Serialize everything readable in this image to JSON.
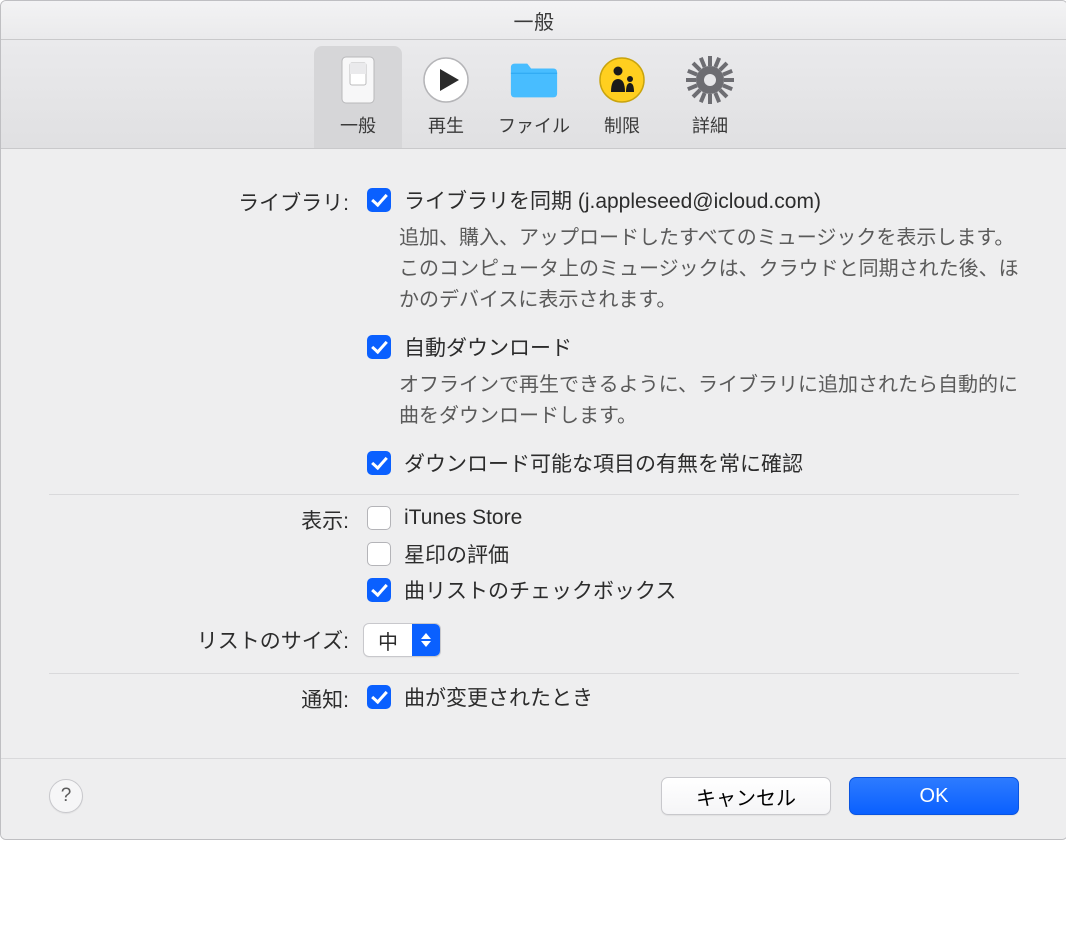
{
  "title": "一般",
  "tabs": [
    {
      "id": "general",
      "label": "一般",
      "selected": true
    },
    {
      "id": "playback",
      "label": "再生",
      "selected": false
    },
    {
      "id": "files",
      "label": "ファイル",
      "selected": false
    },
    {
      "id": "restrictions",
      "label": "制限",
      "selected": false
    },
    {
      "id": "advanced",
      "label": "詳細",
      "selected": false
    }
  ],
  "sections": {
    "library": {
      "label": "ライブラリ:",
      "sync": {
        "checked": true,
        "label": "ライブラリを同期  (j.appleseed@icloud.com)",
        "description": "追加、購入、アップロードしたすべてのミュージックを表示します。このコンピュータ上のミュージックは、クラウドと同期された後、ほかのデバイスに表示されます。"
      },
      "auto_download": {
        "checked": true,
        "label": "自動ダウンロード",
        "description": "オフラインで再生できるように、ライブラリに追加されたら自動的に曲をダウンロードします。"
      },
      "always_check": {
        "checked": true,
        "label": "ダウンロード可能な項目の有無を常に確認"
      }
    },
    "display": {
      "label": "表示:",
      "itunes_store": {
        "checked": false,
        "label": "iTunes Store"
      },
      "star_rating": {
        "checked": false,
        "label": "星印の評価"
      },
      "song_checkboxes": {
        "checked": true,
        "label": "曲リストのチェックボックス"
      }
    },
    "list_size": {
      "label": "リストのサイズ:",
      "value": "中"
    },
    "notifications": {
      "label": "通知:",
      "song_changes": {
        "checked": true,
        "label": "曲が変更されたとき"
      }
    }
  },
  "footer": {
    "cancel": "キャンセル",
    "ok": "OK"
  }
}
